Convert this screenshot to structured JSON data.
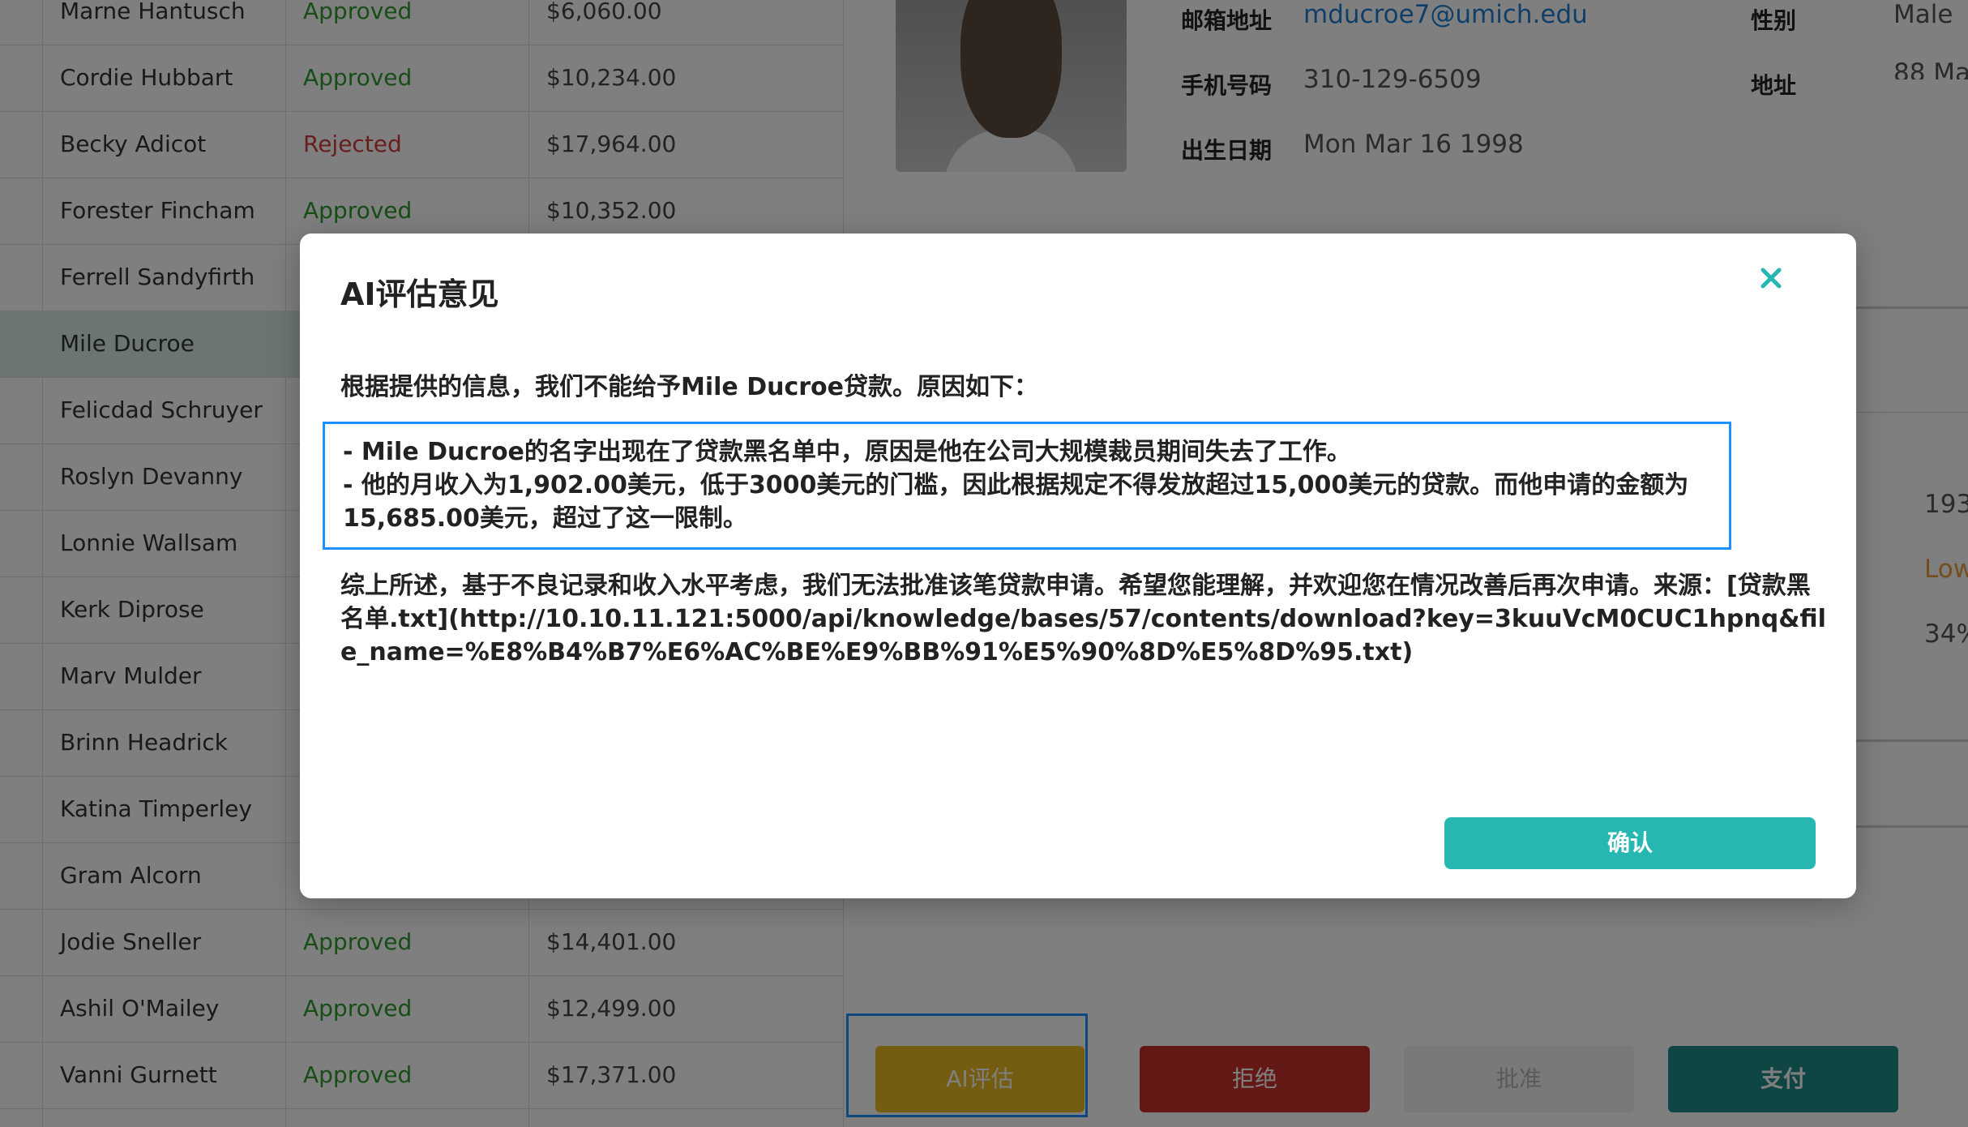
{
  "table": {
    "rows": [
      {
        "name": "Marne Hantusch",
        "status": "Approved",
        "amount": "$6,060.00"
      },
      {
        "name": "Cordie Hubbart",
        "status": "Approved",
        "amount": "$10,234.00"
      },
      {
        "name": "Becky Adicot",
        "status": "Rejected",
        "amount": "$17,964.00"
      },
      {
        "name": "Forester Fincham",
        "status": "Approved",
        "amount": "$10,352.00"
      },
      {
        "name": "Ferrell Sandyfirth",
        "status": "",
        "amount": ""
      },
      {
        "name": "Mile Ducroe",
        "status": "",
        "amount": ""
      },
      {
        "name": "Felicdad Schruyer",
        "status": "",
        "amount": ""
      },
      {
        "name": "Roslyn Devanny",
        "status": "",
        "amount": ""
      },
      {
        "name": "Lonnie Wallsam",
        "status": "",
        "amount": ""
      },
      {
        "name": "Kerk Diprose",
        "status": "",
        "amount": ""
      },
      {
        "name": "Marv Mulder",
        "status": "",
        "amount": ""
      },
      {
        "name": "Brinn Headrick",
        "status": "",
        "amount": ""
      },
      {
        "name": "Katina Timperley",
        "status": "",
        "amount": ""
      },
      {
        "name": "Gram Alcorn",
        "status": "",
        "amount": ""
      },
      {
        "name": "Jodie Sneller",
        "status": "Approved",
        "amount": "$14,401.00"
      },
      {
        "name": "Ashil O'Mailey",
        "status": "Approved",
        "amount": "$12,499.00"
      },
      {
        "name": "Vanni Gurnett",
        "status": "Approved",
        "amount": "$17,371.00"
      }
    ]
  },
  "detail": {
    "email_label": "邮箱地址",
    "email_value": "mducroe7@umich.edu",
    "gender_label": "性别",
    "gender_value": "Male",
    "phone_label": "手机号码",
    "phone_value": "310-129-6509",
    "address_label": "地址",
    "address_value": "88 Ma",
    "dob_label": "出生日期",
    "dob_value": "Mon Mar 16 1998",
    "right_values": [
      "193",
      "Low",
      "34%"
    ]
  },
  "actions": {
    "ai": "AI评估",
    "reject": "拒绝",
    "approve": "批准",
    "pay": "支付"
  },
  "modal": {
    "title": "AI评估意见",
    "close_icon": "close-icon",
    "intro": "根据提供的信息，我们不能给予Mile Ducroe贷款。原因如下：",
    "reasons": [
      "- Mile Ducroe的名字出现在了贷款黑名单中，原因是他在公司大规模裁员期间失去了工作。",
      "- 他的月收入为1,902.00美元，低于3000美元的门槛，因此根据规定不得发放超过15,000美元的贷款。而他申请的金额为15,685.00美元，超过了这一限制。"
    ],
    "summary": "综上所述，基于不良记录和收入水平考虑，我们无法批准该笔贷款申请。希望您能理解，并欢迎您在情况改善后再次申请。来源：[贷款黑名单.txt](http://10.10.11.121:5000/api/knowledge/bases/57/contents/download?key=3kuuVcM0CUC1hpnq&file_name=%E8%B4%B7%E6%AC%BE%E9%BB%91%E5%90%8D%E5%8D%95.txt)",
    "confirm": "确认"
  },
  "colors": {
    "accent": "#26b7b2",
    "highlight_border": "#1e90ff",
    "approved": "#2e9a2e",
    "rejected": "#d33c3c"
  }
}
